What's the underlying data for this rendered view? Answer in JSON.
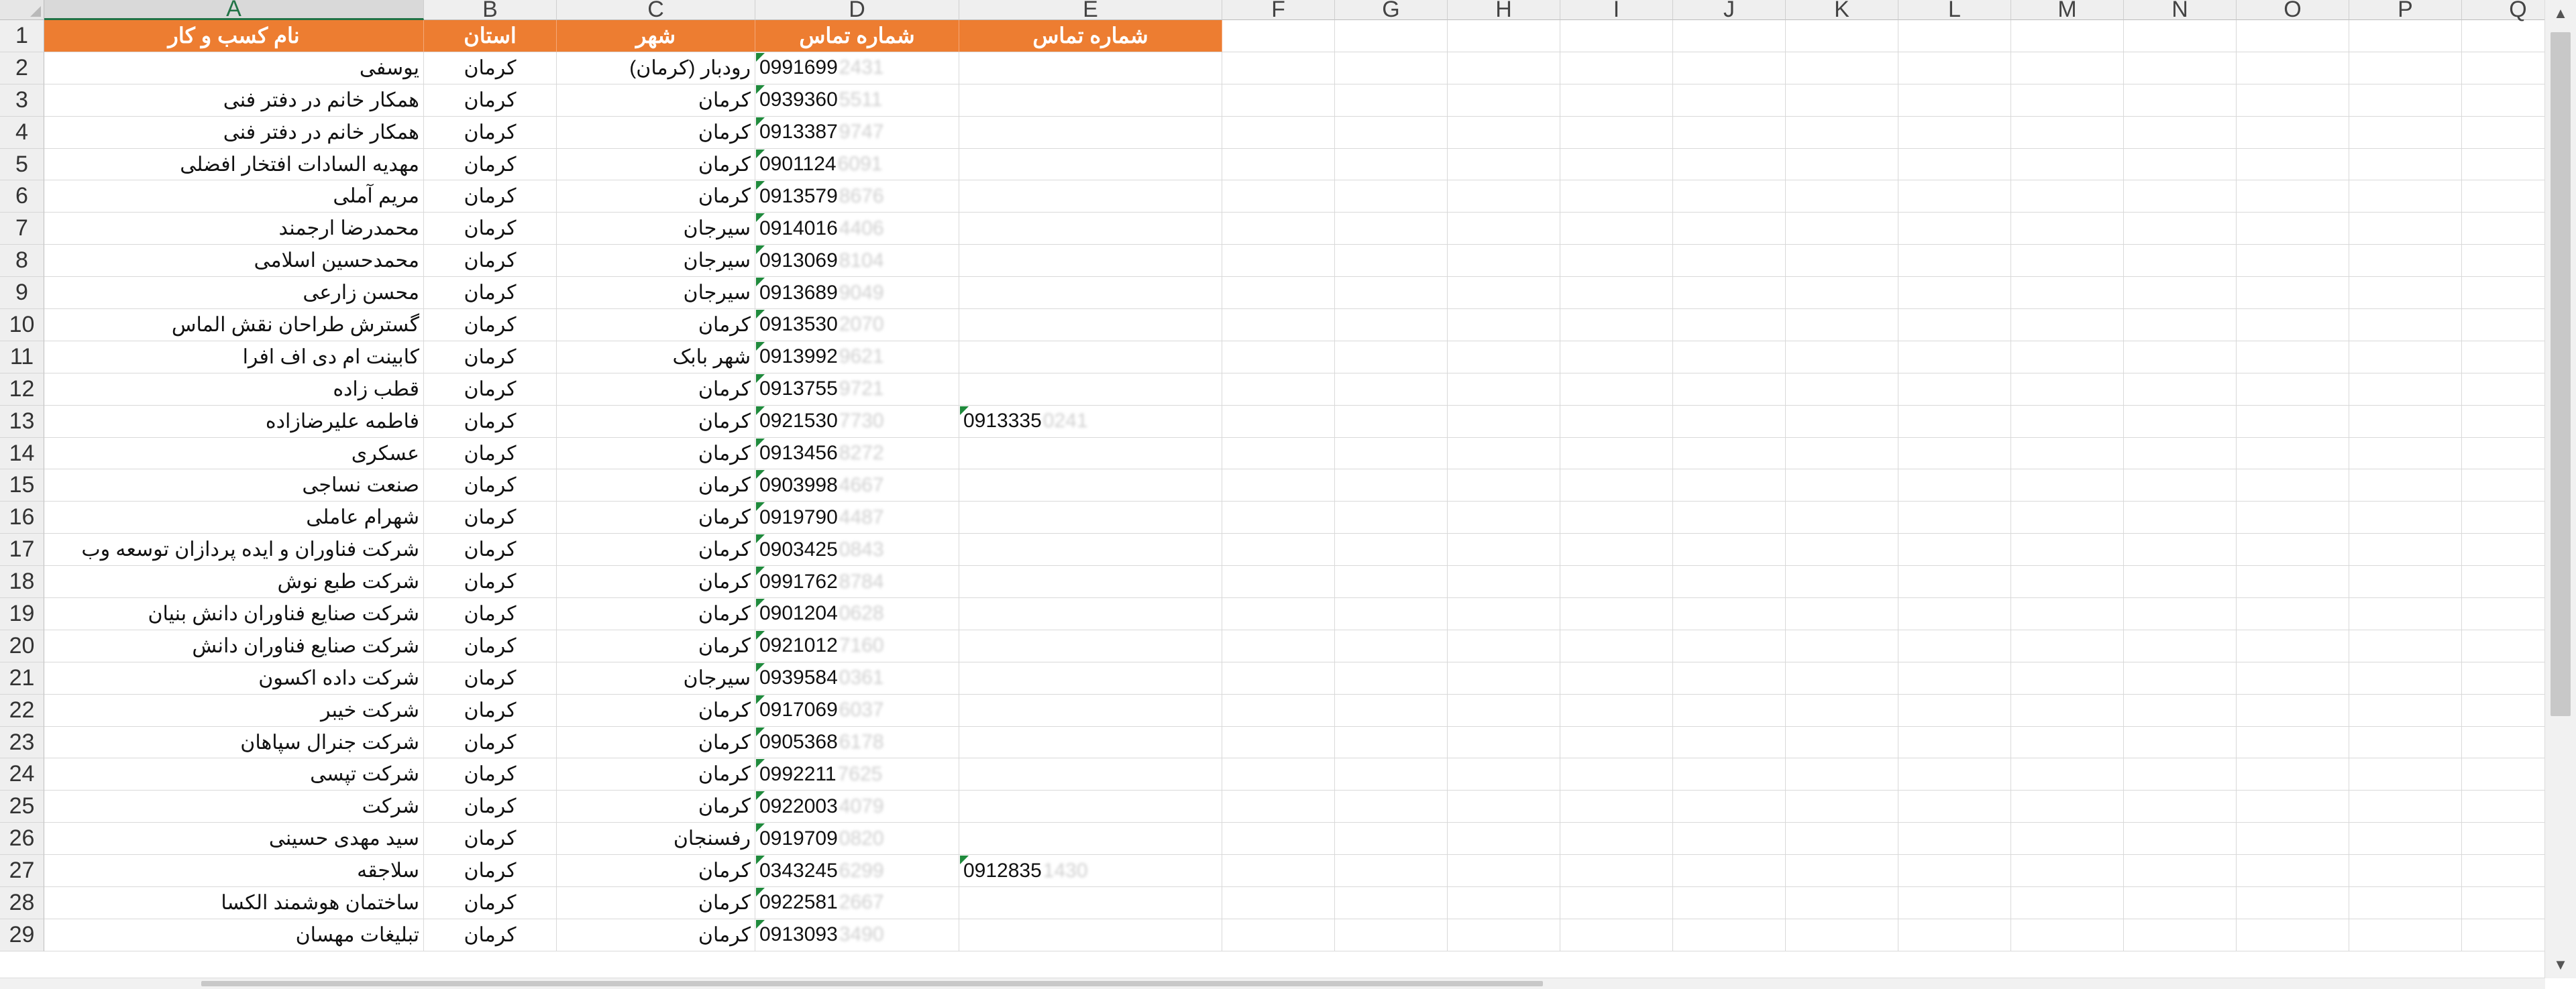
{
  "columns": [
    "A",
    "B",
    "C",
    "D",
    "E",
    "F",
    "G",
    "H",
    "I",
    "J",
    "K",
    "L",
    "M",
    "N",
    "O",
    "P",
    "Q"
  ],
  "selected_column": "A",
  "header": {
    "business_name": "نام کسب و کار",
    "province": "استان",
    "city": "شهر",
    "phone": "شماره تماس",
    "phone2": "شماره تماس"
  },
  "header_color": "#ed7d31",
  "rows": [
    {
      "num": "2",
      "name": "یوسفی",
      "province": "کرمان",
      "city": "رودبار (کرمان)",
      "phone": "0991699",
      "phone_hidden": "2431",
      "phone2": "",
      "phone2_hidden": ""
    },
    {
      "num": "3",
      "name": "همکار خانم در دفتر فنی",
      "province": "کرمان",
      "city": "کرمان",
      "phone": "0939360",
      "phone_hidden": "5511",
      "phone2": "",
      "phone2_hidden": ""
    },
    {
      "num": "4",
      "name": "همکار خانم در دفتر فنی",
      "province": "کرمان",
      "city": "کرمان",
      "phone": "0913387",
      "phone_hidden": "9747",
      "phone2": "",
      "phone2_hidden": ""
    },
    {
      "num": "5",
      "name": "مهدیه السادات افتخار افضلی",
      "province": "کرمان",
      "city": "کرمان",
      "phone": "0901124",
      "phone_hidden": "6091",
      "phone2": "",
      "phone2_hidden": ""
    },
    {
      "num": "6",
      "name": "مریم آملی",
      "province": "کرمان",
      "city": "کرمان",
      "phone": "0913579",
      "phone_hidden": "8676",
      "phone2": "",
      "phone2_hidden": ""
    },
    {
      "num": "7",
      "name": "محمدرضا ارجمند",
      "province": "کرمان",
      "city": "سیرجان",
      "phone": "0914016",
      "phone_hidden": "4406",
      "phone2": "",
      "phone2_hidden": ""
    },
    {
      "num": "8",
      "name": "محمدحسین اسلامی",
      "province": "کرمان",
      "city": "سیرجان",
      "phone": "0913069",
      "phone_hidden": "8104",
      "phone2": "",
      "phone2_hidden": ""
    },
    {
      "num": "9",
      "name": "محسن زارعی",
      "province": "کرمان",
      "city": "سیرجان",
      "phone": "0913689",
      "phone_hidden": "9049",
      "phone2": "",
      "phone2_hidden": ""
    },
    {
      "num": "10",
      "name": "گسترش طراحان نقش الماس",
      "province": "کرمان",
      "city": "کرمان",
      "phone": "0913530",
      "phone_hidden": "2070",
      "phone2": "",
      "phone2_hidden": ""
    },
    {
      "num": "11",
      "name": "کابینت ام دی اف افرا",
      "province": "کرمان",
      "city": "شهر بابک",
      "phone": "0913992",
      "phone_hidden": "9621",
      "phone2": "",
      "phone2_hidden": ""
    },
    {
      "num": "12",
      "name": "قطب زاده",
      "province": "کرمان",
      "city": "کرمان",
      "phone": "0913755",
      "phone_hidden": "9721",
      "phone2": "",
      "phone2_hidden": ""
    },
    {
      "num": "13",
      "name": "فاطمه علیرضازاده",
      "province": "کرمان",
      "city": "کرمان",
      "phone": "0921530",
      "phone_hidden": "7730",
      "phone2": "0913335",
      "phone2_hidden": "0241"
    },
    {
      "num": "14",
      "name": "عسکری",
      "province": "کرمان",
      "city": "کرمان",
      "phone": "0913456",
      "phone_hidden": "8272",
      "phone2": "",
      "phone2_hidden": ""
    },
    {
      "num": "15",
      "name": "صنعت نساجی",
      "province": "کرمان",
      "city": "کرمان",
      "phone": "0903998",
      "phone_hidden": "4667",
      "phone2": "",
      "phone2_hidden": ""
    },
    {
      "num": "16",
      "name": "شهرام عاملی",
      "province": "کرمان",
      "city": "کرمان",
      "phone": "0919790",
      "phone_hidden": "4487",
      "phone2": "",
      "phone2_hidden": ""
    },
    {
      "num": "17",
      "name": "شرکت فناوران و ایده پردازان توسعه وب",
      "province": "کرمان",
      "city": "کرمان",
      "phone": "0903425",
      "phone_hidden": "0843",
      "phone2": "",
      "phone2_hidden": ""
    },
    {
      "num": "18",
      "name": "شرکت طبع نوش",
      "province": "کرمان",
      "city": "کرمان",
      "phone": "0991762",
      "phone_hidden": "8784",
      "phone2": "",
      "phone2_hidden": ""
    },
    {
      "num": "19",
      "name": "شرکت صنایع فناوران دانش بنیان",
      "province": "کرمان",
      "city": "کرمان",
      "phone": "0901204",
      "phone_hidden": "0628",
      "phone2": "",
      "phone2_hidden": ""
    },
    {
      "num": "20",
      "name": "شرکت صنایع فناوران دانش",
      "province": "کرمان",
      "city": "کرمان",
      "phone": "0921012",
      "phone_hidden": "7160",
      "phone2": "",
      "phone2_hidden": ""
    },
    {
      "num": "21",
      "name": "شرکت داده اکسون",
      "province": "کرمان",
      "city": "سیرجان",
      "phone": "0939584",
      "phone_hidden": "0361",
      "phone2": "",
      "phone2_hidden": ""
    },
    {
      "num": "22",
      "name": "شرکت خیبر",
      "province": "کرمان",
      "city": "کرمان",
      "phone": "0917069",
      "phone_hidden": "6037",
      "phone2": "",
      "phone2_hidden": ""
    },
    {
      "num": "23",
      "name": "شرکت جنرال سپاهان",
      "province": "کرمان",
      "city": "کرمان",
      "phone": "0905368",
      "phone_hidden": "6178",
      "phone2": "",
      "phone2_hidden": ""
    },
    {
      "num": "24",
      "name": "شرکت تپسی",
      "province": "کرمان",
      "city": "کرمان",
      "phone": "0992211",
      "phone_hidden": "7625",
      "phone2": "",
      "phone2_hidden": ""
    },
    {
      "num": "25",
      "name": "شرکت",
      "province": "کرمان",
      "city": "کرمان",
      "phone": "0922003",
      "phone_hidden": "4079",
      "phone2": "",
      "phone2_hidden": ""
    },
    {
      "num": "26",
      "name": "سید مهدی حسینی",
      "province": "کرمان",
      "city": "رفسنجان",
      "phone": "0919709",
      "phone_hidden": "0820",
      "phone2": "",
      "phone2_hidden": ""
    },
    {
      "num": "27",
      "name": "سلاجقه",
      "province": "کرمان",
      "city": "کرمان",
      "phone": "0343245",
      "phone_hidden": "6299",
      "phone2": "0912835",
      "phone2_hidden": "1430"
    },
    {
      "num": "28",
      "name": "ساختمان هوشمند الکسا",
      "province": "کرمان",
      "city": "کرمان",
      "phone": "0922581",
      "phone_hidden": "2667",
      "phone2": "",
      "phone2_hidden": ""
    },
    {
      "num": "29",
      "name": "تبلیغات مهسان",
      "province": "کرمان",
      "city": "کرمان",
      "phone": "0913093",
      "phone_hidden": "3490",
      "phone2": "",
      "phone2_hidden": ""
    }
  ]
}
